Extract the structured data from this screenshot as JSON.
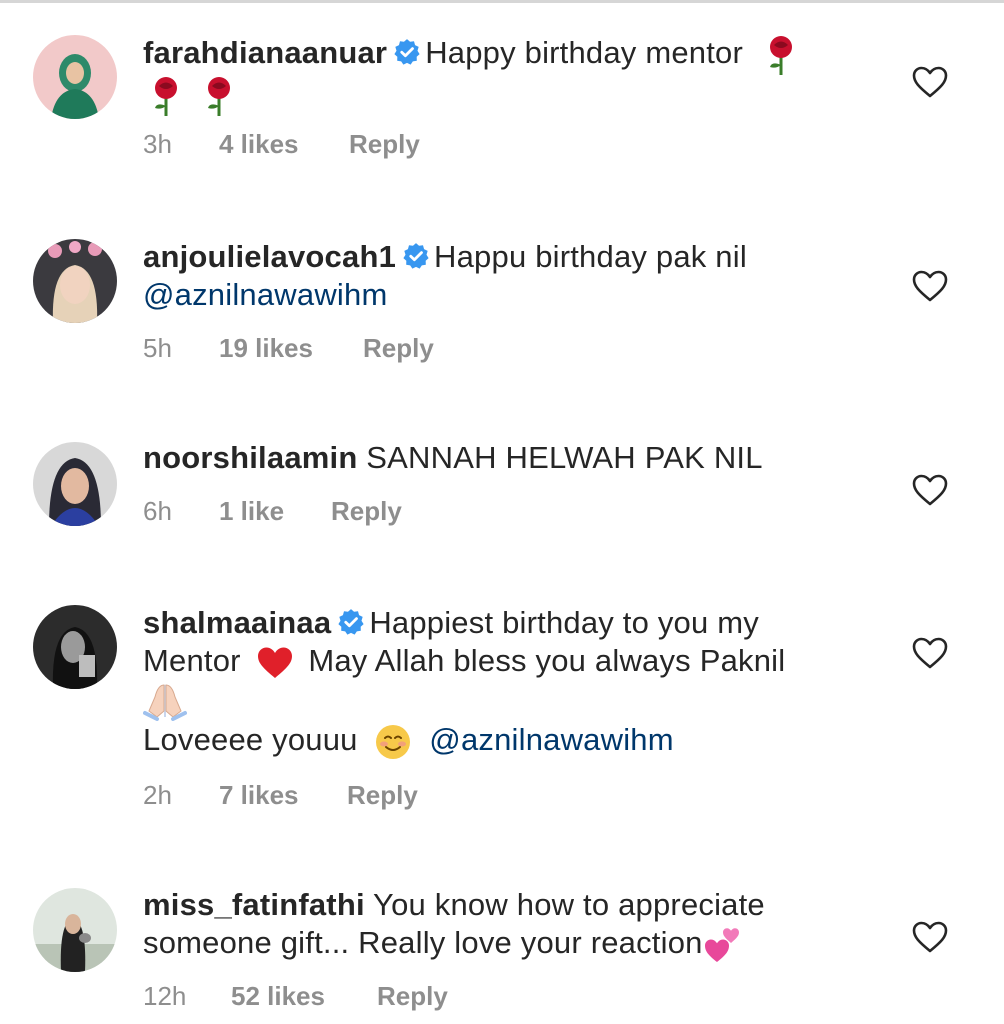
{
  "comments": [
    {
      "username": "farahdianaanuar",
      "verified": true,
      "line1": "Happy birthday mentor",
      "time": "3h",
      "likes": "4 likes",
      "reply": "Reply"
    },
    {
      "username": "anjoulielavocah1",
      "verified": true,
      "line1": "Happu birthday pak nil",
      "mention": "@aznilnawawihm",
      "time": "5h",
      "likes": "19 likes",
      "reply": "Reply"
    },
    {
      "username": "noorshilaamin",
      "verified": false,
      "line1": "SANNAH HELWAH PAK NIL",
      "time": "6h",
      "likes": "1 like",
      "reply": "Reply"
    },
    {
      "username": "shalmaainaa",
      "verified": true,
      "line1": "Happiest birthday to you my",
      "line2a": "Mentor",
      "line2b": "May Allah bless you always Paknil",
      "line4": "Loveeee youuu",
      "mention": "@aznilnawawihm",
      "time": "2h",
      "likes": "7 likes",
      "reply": "Reply"
    },
    {
      "username": "miss_fatinfathi",
      "verified": false,
      "line1": "You know how to appreciate",
      "line2": "someone gift... Really love your reaction",
      "time": "12h",
      "likes": "52 likes",
      "reply": "Reply"
    }
  ],
  "colors": {
    "text": "#262626",
    "muted": "#8e8e8e",
    "mention": "#00376b",
    "verified": "#3897f0"
  },
  "icons": [
    "verified-badge-icon",
    "heart-outline-icon",
    "rose-emoji",
    "red-heart-emoji",
    "folded-hands-emoji",
    "smiling-face-emoji",
    "two-hearts-emoji"
  ]
}
